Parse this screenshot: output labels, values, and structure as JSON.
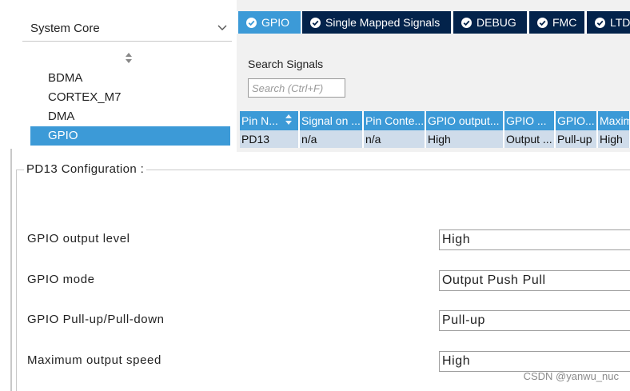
{
  "left_panel": {
    "category": "System Core",
    "peripherals": [
      {
        "label": "BDMA",
        "selected": false
      },
      {
        "label": "CORTEX_M7",
        "selected": false
      },
      {
        "label": "DMA",
        "selected": false
      },
      {
        "label": "GPIO",
        "selected": true
      }
    ]
  },
  "tabs": [
    {
      "label": "GPIO",
      "active": true
    },
    {
      "label": "Single Mapped Signals",
      "active": false
    },
    {
      "label": "DEBUG",
      "active": false
    },
    {
      "label": "FMC",
      "active": false
    },
    {
      "label": "LTDC",
      "active": false
    }
  ],
  "search": {
    "label": "Search Signals",
    "placeholder": "Search (Ctrl+F)",
    "value": ""
  },
  "signal_table": {
    "columns": [
      "Pin N...",
      "Signal on ...",
      "Pin Conte...",
      "GPIO output...",
      "GPIO ...",
      "GPIO...",
      "Maxim"
    ],
    "rows": [
      [
        "PD13",
        "n/a",
        "n/a",
        "High",
        "Output ...",
        "Pull-up",
        "High"
      ]
    ]
  },
  "configuration": {
    "title": "PD13 Configuration :",
    "parameters": [
      {
        "label": "GPIO output level",
        "value": "High"
      },
      {
        "label": "GPIO mode",
        "value": "Output Push Pull"
      },
      {
        "label": "GPIO Pull-up/Pull-down",
        "value": "Pull-up"
      },
      {
        "label": "Maximum output speed",
        "value": "High"
      }
    ]
  },
  "watermark": "CSDN @yanwu_nuc",
  "colors": {
    "accent": "#3c9ad7",
    "tab_dark": "#03234b",
    "row_bg": "#cfdcea"
  }
}
